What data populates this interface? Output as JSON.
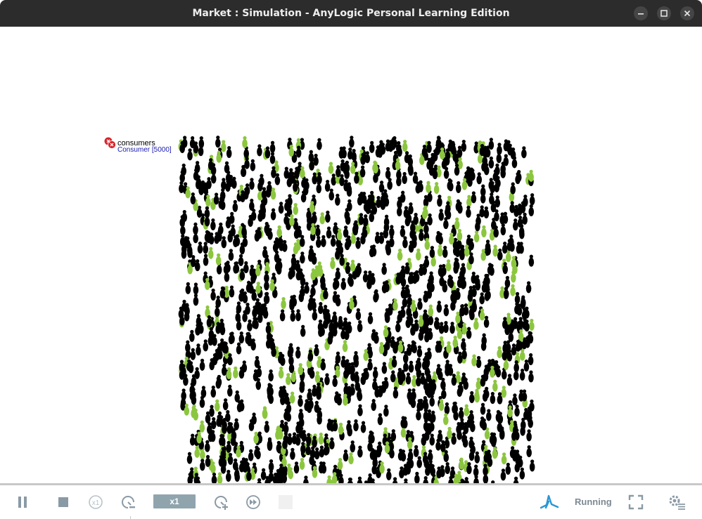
{
  "window": {
    "title": "Market : Simulation - AnyLogic Personal Learning Edition",
    "controls": [
      "minimize-icon",
      "maximize-icon",
      "close-icon"
    ]
  },
  "canvas": {
    "population_label": {
      "name": "consumers",
      "type_and_count": "Consumer [5000]",
      "icon": "agent-population-icon"
    },
    "crowd": {
      "agent_icon": "person-icon",
      "agent_colors": {
        "default": "#000000",
        "adopter": "#8cc63f"
      },
      "agent_count": 5000
    }
  },
  "toolbar": {
    "pause_icon": "pause-icon",
    "stop_icon": "stop-icon",
    "realtime_icon": "x1-realtime-icon",
    "slow_down_icon": "slow-down-icon",
    "speed_label": "x1",
    "speed_up_icon": "speed-up-icon",
    "fast_forward_icon": "fast-forward-icon",
    "step_icon": "step-icon",
    "logo_icon": "anylogic-logo-icon",
    "status": "Running",
    "fullscreen_icon": "fullscreen-icon",
    "settings_icon": "settings-icon",
    "colors": {
      "icon": "#8a9aa5",
      "accent": "#2a96d6",
      "speed_bg": "#90a4ae"
    }
  }
}
